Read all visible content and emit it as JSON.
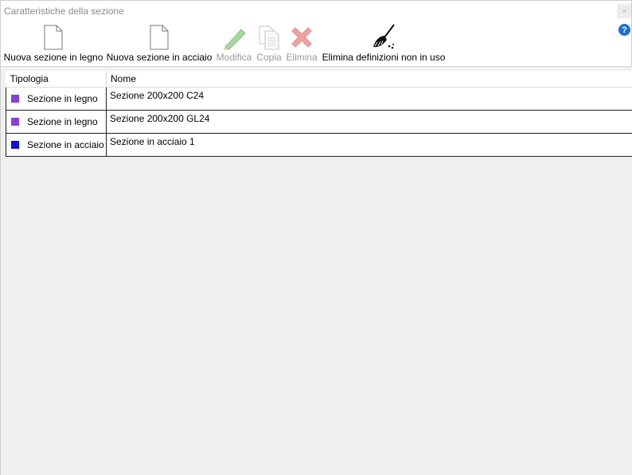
{
  "window": {
    "title": "Caratteristiche della sezione",
    "close_label": "×",
    "help_label": "?"
  },
  "toolbar": {
    "new_wood": "Nuova sezione in legno",
    "new_steel": "Nuova sezione in acciaio",
    "edit": "Modifica",
    "copy": "Copia",
    "delete": "Elimina",
    "purge": "Elimina definizioni non in uso"
  },
  "icons": {
    "new_wood": "new-document-icon",
    "new_steel": "new-document-icon",
    "edit": "pencil-icon",
    "copy": "copy-icon",
    "delete": "delete-x-icon",
    "purge": "broom-icon"
  },
  "table": {
    "columns": [
      "Tipologia",
      "Nome"
    ],
    "rows": [
      {
        "tipologia": "Sezione in legno",
        "nome": "Sezione 200x200 C24",
        "color": "#8a3fd6"
      },
      {
        "tipologia": "Sezione in legno",
        "nome": "Sezione 200x200 GL24",
        "color": "#8a3fd6"
      },
      {
        "tipologia": "Sezione in acciaio",
        "nome": "Sezione in acciaio 1",
        "color": "#1010d8"
      }
    ]
  }
}
